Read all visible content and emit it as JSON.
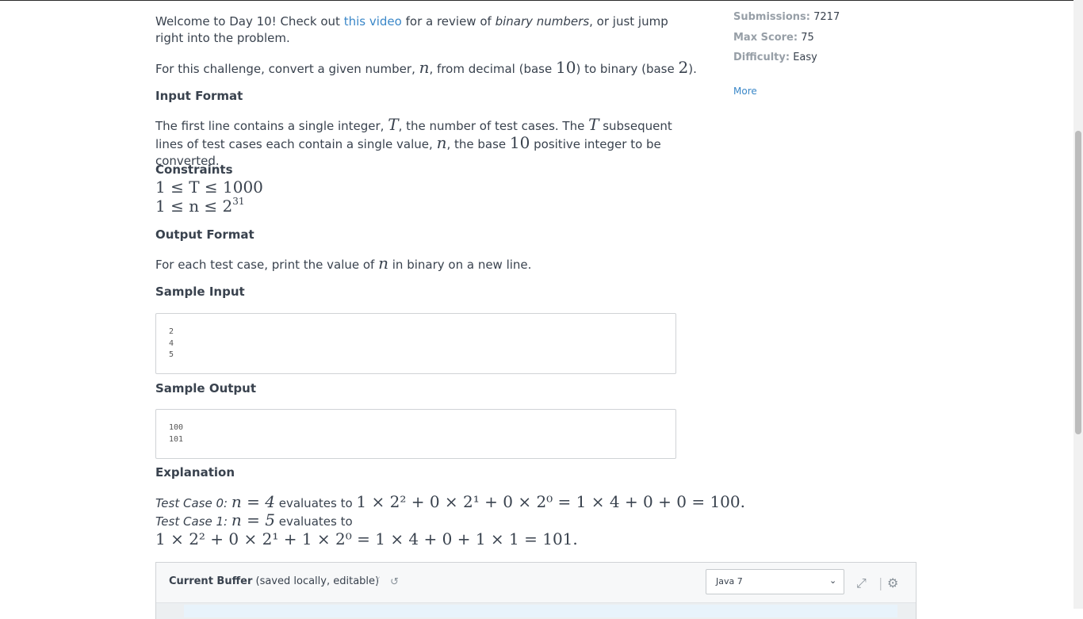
{
  "intro": {
    "text_before": "Welcome to Day 10! Check out ",
    "link": "this video",
    "text_middle": " for a review of ",
    "emphasis": "binary numbers",
    "text_after": ", or just jump right into the problem."
  },
  "task": {
    "before": "For this challenge, convert a given number, ",
    "var": "n",
    "middle": ", from decimal (base ",
    "base10": "10",
    "middle2": ") to binary (base ",
    "base2": "2",
    "after": ")."
  },
  "input_format": {
    "heading": "Input Format",
    "p1": "The first line contains a single integer, ",
    "T": "T",
    "p2": ", the number of test cases. The ",
    "p3": " subsequent lines of test cases each contain a single value, ",
    "n": "n",
    "p4": ", the base ",
    "ten": "10",
    "p5": " positive integer to be converted."
  },
  "constraints": {
    "heading": "Constraints",
    "c1": "1 ≤ T ≤ 1000",
    "c2_base": "1 ≤ n ≤ 2",
    "c2_exp": "31"
  },
  "output_format": {
    "heading": "Output Format",
    "p1": "For each test case, print the value of ",
    "n": "n",
    "p2": " in binary on a new line."
  },
  "sample_input": {
    "heading": "Sample Input",
    "code": "2\n4\n5"
  },
  "sample_output": {
    "heading": "Sample Output",
    "code": "100\n101"
  },
  "explanation": {
    "heading": "Explanation",
    "tc0_label": "Test Case 0:",
    "tc0_eq": "n = 4",
    "evaluates": "evaluates to",
    "tc0_expr": "1 × 2² + 0 × 2¹ + 0 × 2⁰ = 1 × 4 + 0 + 0 = 100.",
    "tc1_label": "Test Case 1:",
    "tc1_eq": "n = 5",
    "tc1_expr": "1 × 2² + 0 × 2¹ + 1 × 2⁰ = 1 × 4 + 0 + 1 × 1 = 101."
  },
  "sidebar": {
    "submissions_label": "Submissions:",
    "submissions_value": "7217",
    "max_score_label": "Max Score:",
    "max_score_value": "75",
    "difficulty_label": "Difficulty:",
    "difficulty_value": "Easy",
    "more": "More"
  },
  "editor": {
    "title_bold": "Current Buffer",
    "title_rest": " (saved locally, editable)",
    "language": "Java 7",
    "icons": [
      "branch-icon",
      "history-icon",
      "fullscreen-icon",
      "settings-gear-icon"
    ]
  },
  "colors": {
    "link": "#3a87c8",
    "text": "#39424e",
    "muted_label": "#979fa7"
  }
}
